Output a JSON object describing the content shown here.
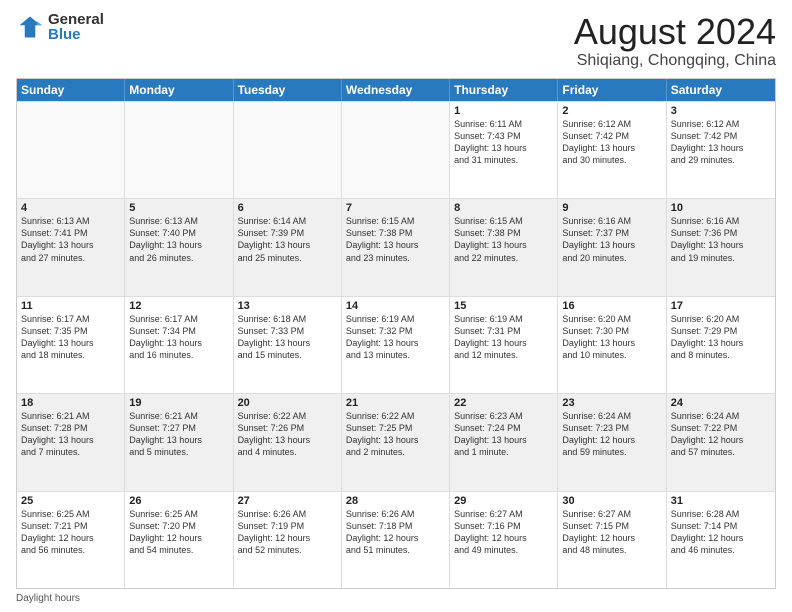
{
  "logo": {
    "general": "General",
    "blue": "Blue"
  },
  "title": "August 2024",
  "subtitle": "Shiqiang, Chongqing, China",
  "weekdays": [
    "Sunday",
    "Monday",
    "Tuesday",
    "Wednesday",
    "Thursday",
    "Friday",
    "Saturday"
  ],
  "footer_label": "Daylight hours",
  "rows": [
    [
      {
        "day": "",
        "info": "",
        "empty": true
      },
      {
        "day": "",
        "info": "",
        "empty": true
      },
      {
        "day": "",
        "info": "",
        "empty": true
      },
      {
        "day": "",
        "info": "",
        "empty": true
      },
      {
        "day": "1",
        "info": "Sunrise: 6:11 AM\nSunset: 7:43 PM\nDaylight: 13 hours\nand 31 minutes."
      },
      {
        "day": "2",
        "info": "Sunrise: 6:12 AM\nSunset: 7:42 PM\nDaylight: 13 hours\nand 30 minutes."
      },
      {
        "day": "3",
        "info": "Sunrise: 6:12 AM\nSunset: 7:42 PM\nDaylight: 13 hours\nand 29 minutes."
      }
    ],
    [
      {
        "day": "4",
        "info": "Sunrise: 6:13 AM\nSunset: 7:41 PM\nDaylight: 13 hours\nand 27 minutes."
      },
      {
        "day": "5",
        "info": "Sunrise: 6:13 AM\nSunset: 7:40 PM\nDaylight: 13 hours\nand 26 minutes."
      },
      {
        "day": "6",
        "info": "Sunrise: 6:14 AM\nSunset: 7:39 PM\nDaylight: 13 hours\nand 25 minutes."
      },
      {
        "day": "7",
        "info": "Sunrise: 6:15 AM\nSunset: 7:38 PM\nDaylight: 13 hours\nand 23 minutes."
      },
      {
        "day": "8",
        "info": "Sunrise: 6:15 AM\nSunset: 7:38 PM\nDaylight: 13 hours\nand 22 minutes."
      },
      {
        "day": "9",
        "info": "Sunrise: 6:16 AM\nSunset: 7:37 PM\nDaylight: 13 hours\nand 20 minutes."
      },
      {
        "day": "10",
        "info": "Sunrise: 6:16 AM\nSunset: 7:36 PM\nDaylight: 13 hours\nand 19 minutes."
      }
    ],
    [
      {
        "day": "11",
        "info": "Sunrise: 6:17 AM\nSunset: 7:35 PM\nDaylight: 13 hours\nand 18 minutes."
      },
      {
        "day": "12",
        "info": "Sunrise: 6:17 AM\nSunset: 7:34 PM\nDaylight: 13 hours\nand 16 minutes."
      },
      {
        "day": "13",
        "info": "Sunrise: 6:18 AM\nSunset: 7:33 PM\nDaylight: 13 hours\nand 15 minutes."
      },
      {
        "day": "14",
        "info": "Sunrise: 6:19 AM\nSunset: 7:32 PM\nDaylight: 13 hours\nand 13 minutes."
      },
      {
        "day": "15",
        "info": "Sunrise: 6:19 AM\nSunset: 7:31 PM\nDaylight: 13 hours\nand 12 minutes."
      },
      {
        "day": "16",
        "info": "Sunrise: 6:20 AM\nSunset: 7:30 PM\nDaylight: 13 hours\nand 10 minutes."
      },
      {
        "day": "17",
        "info": "Sunrise: 6:20 AM\nSunset: 7:29 PM\nDaylight: 13 hours\nand 8 minutes."
      }
    ],
    [
      {
        "day": "18",
        "info": "Sunrise: 6:21 AM\nSunset: 7:28 PM\nDaylight: 13 hours\nand 7 minutes."
      },
      {
        "day": "19",
        "info": "Sunrise: 6:21 AM\nSunset: 7:27 PM\nDaylight: 13 hours\nand 5 minutes."
      },
      {
        "day": "20",
        "info": "Sunrise: 6:22 AM\nSunset: 7:26 PM\nDaylight: 13 hours\nand 4 minutes."
      },
      {
        "day": "21",
        "info": "Sunrise: 6:22 AM\nSunset: 7:25 PM\nDaylight: 13 hours\nand 2 minutes."
      },
      {
        "day": "22",
        "info": "Sunrise: 6:23 AM\nSunset: 7:24 PM\nDaylight: 13 hours\nand 1 minute."
      },
      {
        "day": "23",
        "info": "Sunrise: 6:24 AM\nSunset: 7:23 PM\nDaylight: 12 hours\nand 59 minutes."
      },
      {
        "day": "24",
        "info": "Sunrise: 6:24 AM\nSunset: 7:22 PM\nDaylight: 12 hours\nand 57 minutes."
      }
    ],
    [
      {
        "day": "25",
        "info": "Sunrise: 6:25 AM\nSunset: 7:21 PM\nDaylight: 12 hours\nand 56 minutes."
      },
      {
        "day": "26",
        "info": "Sunrise: 6:25 AM\nSunset: 7:20 PM\nDaylight: 12 hours\nand 54 minutes."
      },
      {
        "day": "27",
        "info": "Sunrise: 6:26 AM\nSunset: 7:19 PM\nDaylight: 12 hours\nand 52 minutes."
      },
      {
        "day": "28",
        "info": "Sunrise: 6:26 AM\nSunset: 7:18 PM\nDaylight: 12 hours\nand 51 minutes."
      },
      {
        "day": "29",
        "info": "Sunrise: 6:27 AM\nSunset: 7:16 PM\nDaylight: 12 hours\nand 49 minutes."
      },
      {
        "day": "30",
        "info": "Sunrise: 6:27 AM\nSunset: 7:15 PM\nDaylight: 12 hours\nand 48 minutes."
      },
      {
        "day": "31",
        "info": "Sunrise: 6:28 AM\nSunset: 7:14 PM\nDaylight: 12 hours\nand 46 minutes."
      }
    ]
  ]
}
